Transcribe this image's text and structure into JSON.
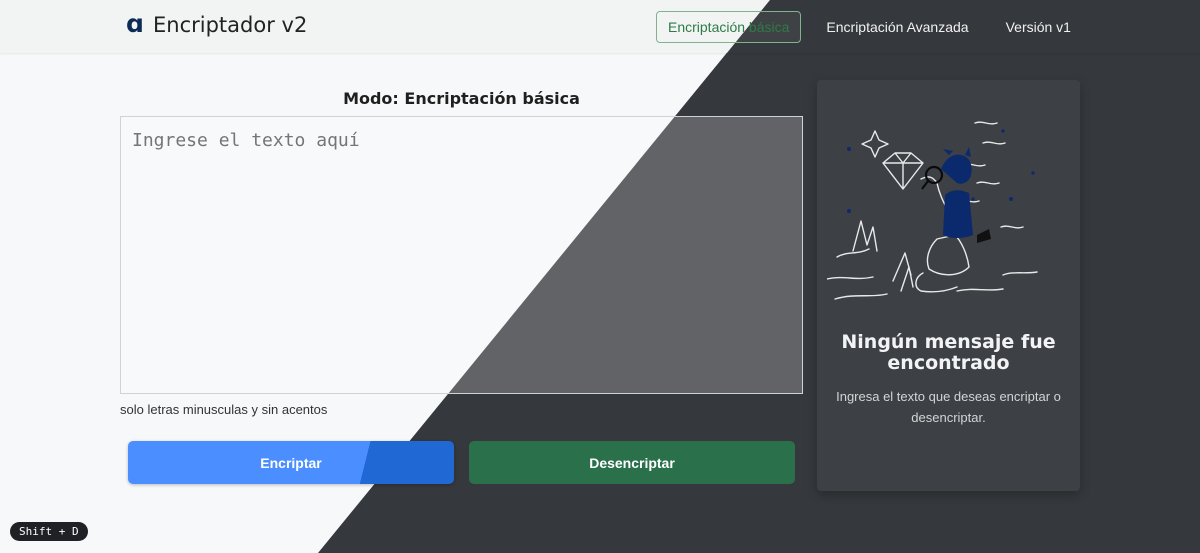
{
  "brand": {
    "title": "Encriptador v2",
    "logo_icon": "a-logo-icon"
  },
  "nav": [
    {
      "label": "Encriptación básica",
      "active": true
    },
    {
      "label": "Encriptación Avanzada",
      "active": false
    },
    {
      "label": "Versión v1",
      "active": false
    }
  ],
  "main": {
    "mode_title": "Modo: Encriptación básica",
    "textarea_placeholder": "Ingrese el texto aquí",
    "hint": "solo letras minusculas y sin acentos",
    "encrypt_label": "Encriptar",
    "decrypt_label": "Desencriptar"
  },
  "card": {
    "title": "Ningún mensaje fue encontrado",
    "text": "Ingresa el texto que deseas encriptar o desencriptar."
  },
  "shortcut": "Shift + D",
  "colors": {
    "dark_bg": "#35383c",
    "light_bg": "#f7f8f9",
    "encrypt_button": "#4a8eff",
    "decrypt_button": "#2a704b",
    "active_nav_border": "#7fb38f"
  }
}
